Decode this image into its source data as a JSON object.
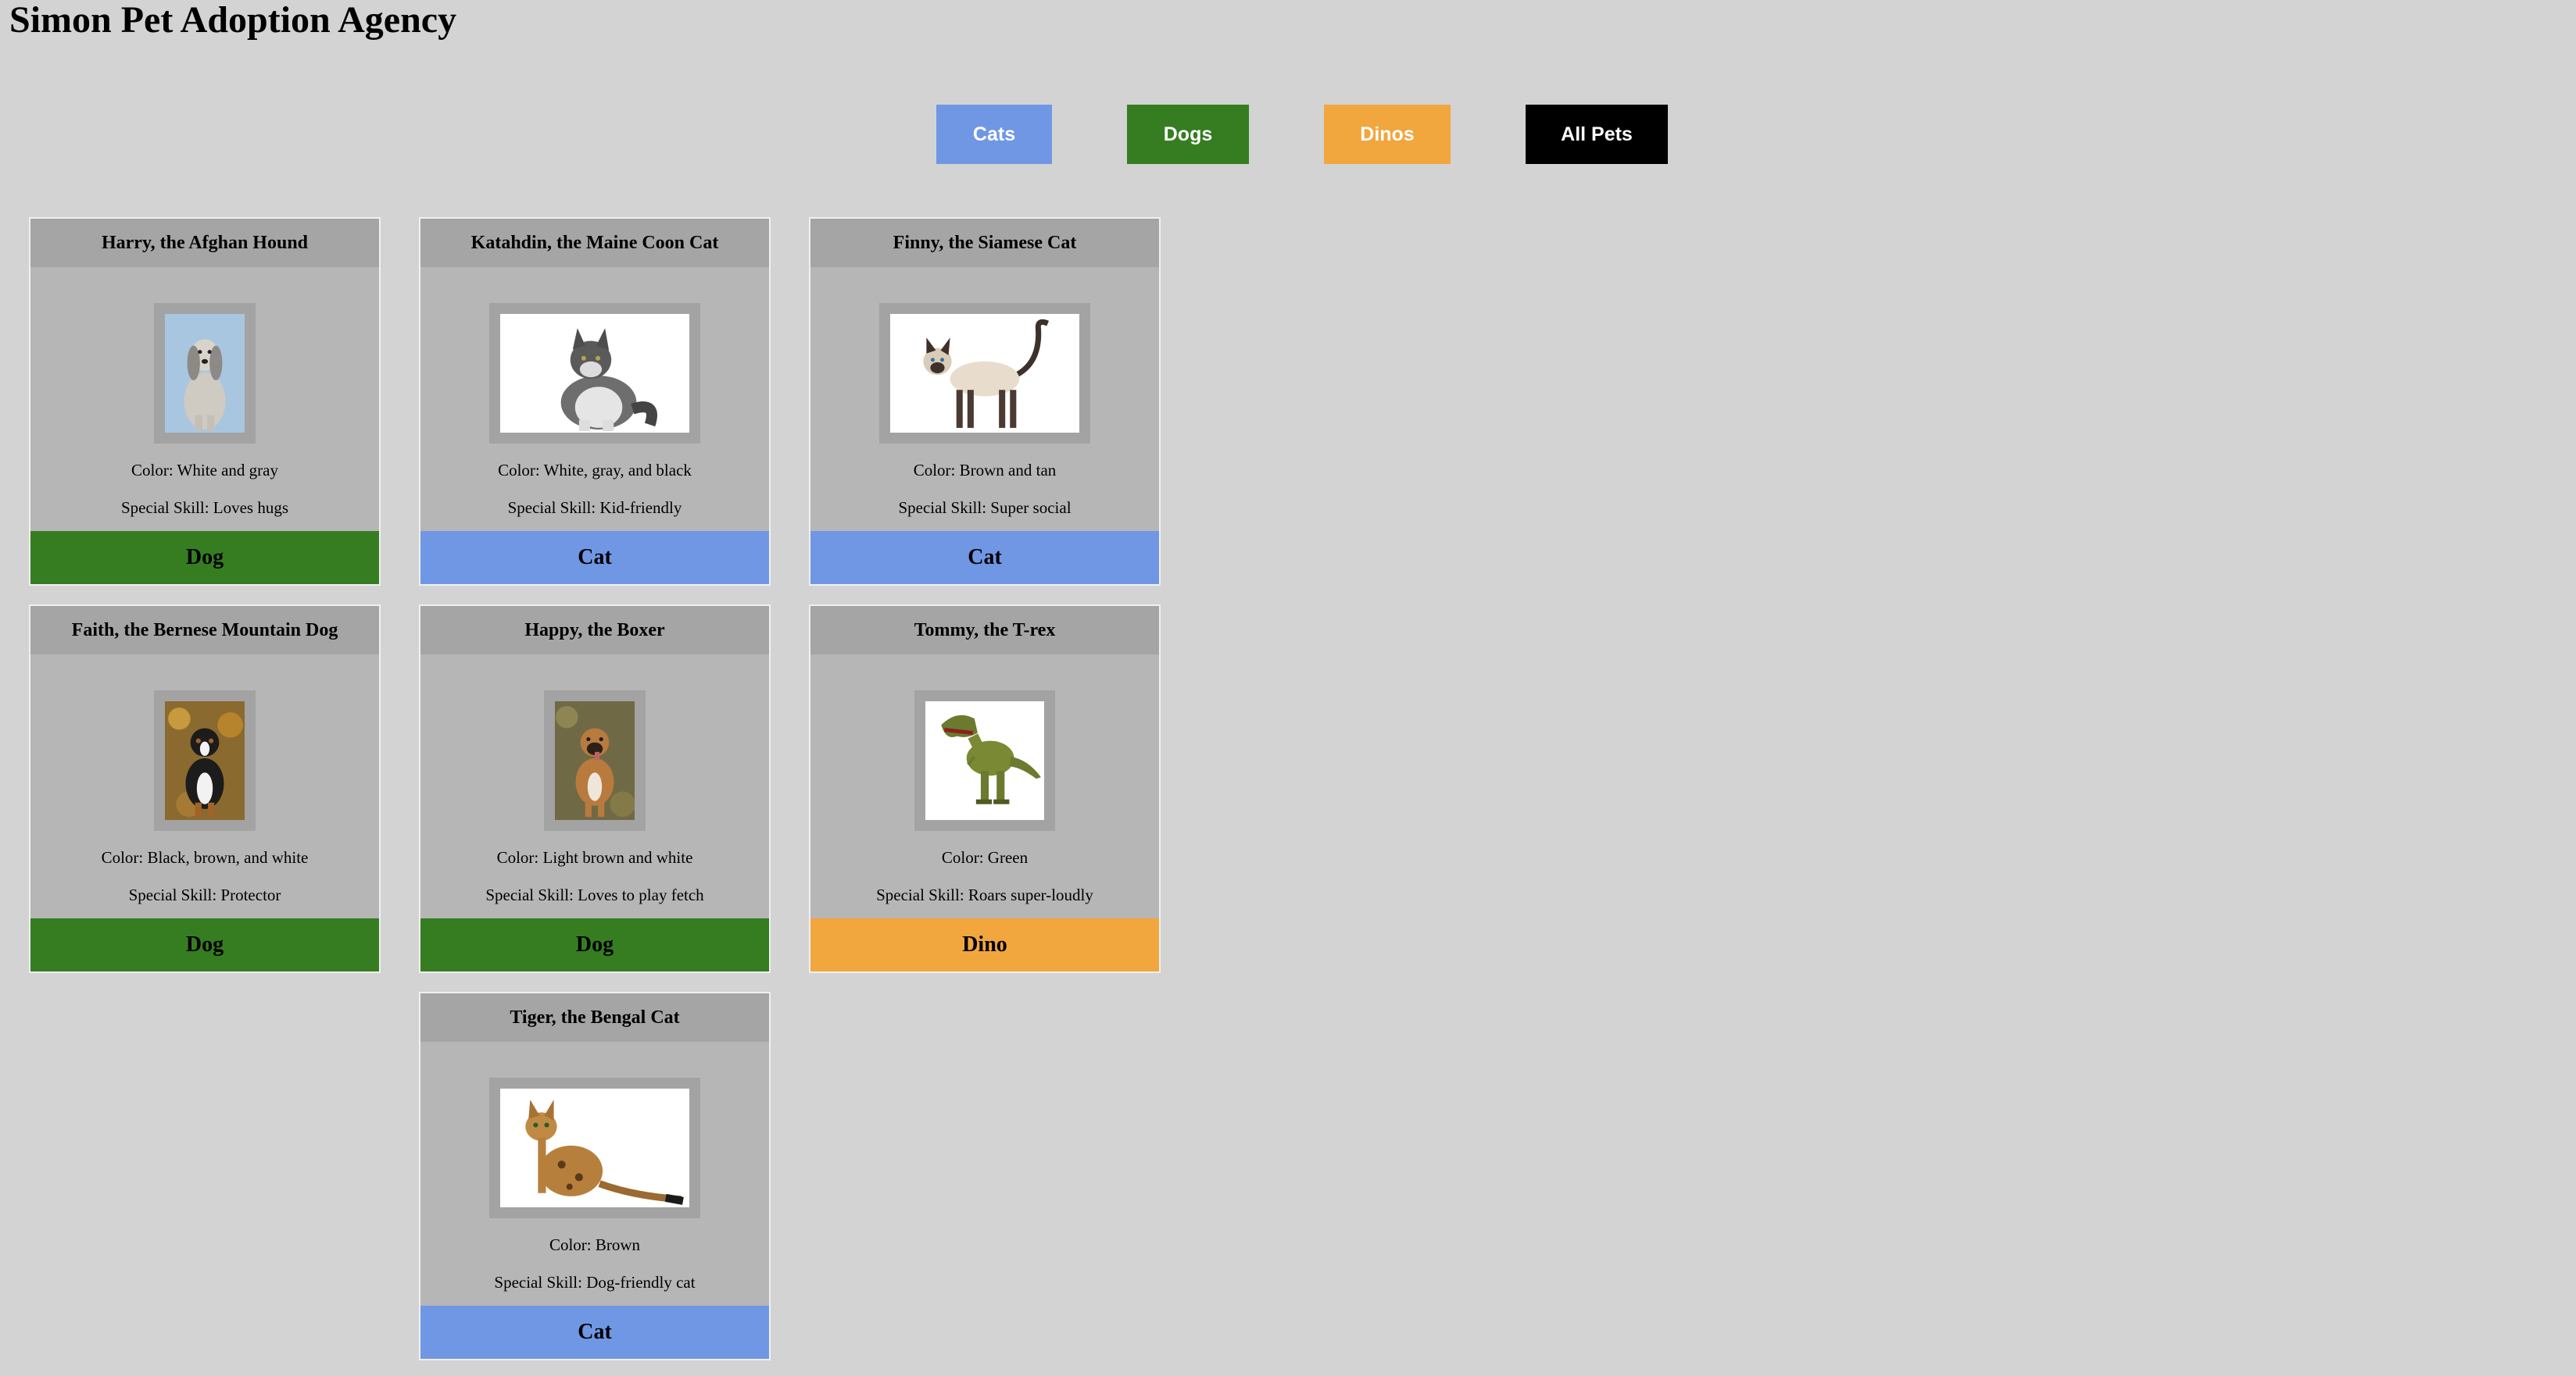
{
  "title": "Simon Pet Adoption Agency",
  "filters": {
    "cats": {
      "label": "Cats",
      "color": "#6f97e4"
    },
    "dogs": {
      "label": "Dogs",
      "color": "#367d21"
    },
    "dinos": {
      "label": "Dinos",
      "color": "#f1a63e"
    },
    "all": {
      "label": "All Pets",
      "color": "#000000"
    }
  },
  "pets": [
    {
      "name": "Harry, the Afghan Hound",
      "color": "Color: White and gray",
      "skill": "Special Skill: Loves hugs",
      "type": "Dog"
    },
    {
      "name": "Katahdin, the Maine Coon Cat",
      "color": "Color: White, gray, and black",
      "skill": "Special Skill: Kid-friendly",
      "type": "Cat"
    },
    {
      "name": "Finny, the Siamese Cat",
      "color": "Color: Brown and tan",
      "skill": "Special Skill: Super social",
      "type": "Cat"
    },
    {
      "name": "Faith, the Bernese Mountain Dog",
      "color": "Color: Black, brown, and white",
      "skill": "Special Skill: Protector",
      "type": "Dog"
    },
    {
      "name": "Happy, the Boxer",
      "color": "Color: Light brown and white",
      "skill": "Special Skill: Loves to play fetch",
      "type": "Dog"
    },
    {
      "name": "Tommy, the T-rex",
      "color": "Color: Green",
      "skill": "Special Skill: Roars super-loudly",
      "type": "Dino"
    },
    {
      "name": "Tiger, the Bengal Cat",
      "color": "Color: Brown",
      "skill": "Special Skill: Dog-friendly cat",
      "type": "Cat"
    }
  ],
  "type_colors": {
    "Dog": "#367d21",
    "Cat": "#6f97e4",
    "Dino": "#f1a63e"
  }
}
